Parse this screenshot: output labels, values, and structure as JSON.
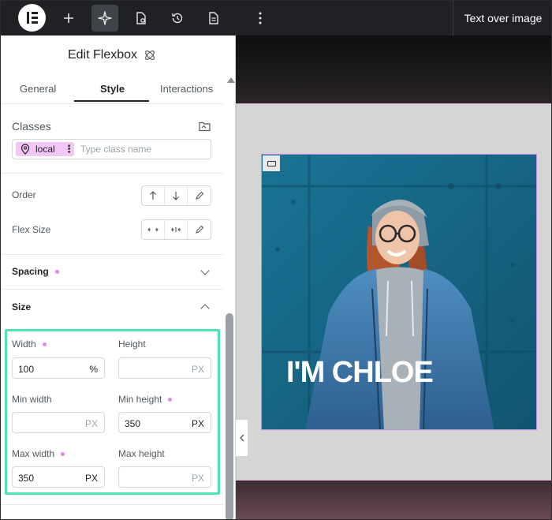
{
  "topbar": {
    "title": "Text over image",
    "buttons": [
      "add-icon",
      "sparkle-icon",
      "page-settings-icon",
      "history-icon",
      "document-icon",
      "more-vertical-icon"
    ]
  },
  "panel": {
    "header_title": "Edit Flexbox",
    "tabs": [
      {
        "label": "General"
      },
      {
        "label": "Style",
        "selected": true
      },
      {
        "label": "Interactions"
      }
    ],
    "classes": {
      "label": "Classes",
      "chip_label": "local",
      "placeholder": "Type class name"
    },
    "order": {
      "label": "Order"
    },
    "flex_size": {
      "label": "Flex Size"
    },
    "spacing": {
      "title": "Spacing"
    },
    "size": {
      "title": "Size",
      "width": {
        "label": "Width",
        "value": "100",
        "unit": "%"
      },
      "height": {
        "label": "Height",
        "value": "",
        "unit": "PX"
      },
      "min_width": {
        "label": "Min width",
        "value": "",
        "unit": "PX"
      },
      "min_height": {
        "label": "Min height",
        "value": "350",
        "unit": "PX"
      },
      "max_width": {
        "label": "Max width",
        "value": "350",
        "unit": "PX"
      },
      "max_height": {
        "label": "Max height",
        "value": "",
        "unit": "PX"
      }
    }
  },
  "canvas": {
    "headline": "I'M CHLOE"
  },
  "colors": {
    "topbar_bg": "#1f2124",
    "accent_pink": "#f2c6f5",
    "highlight_green": "#4fe3b1",
    "outline_purple": "#c18ee8"
  }
}
